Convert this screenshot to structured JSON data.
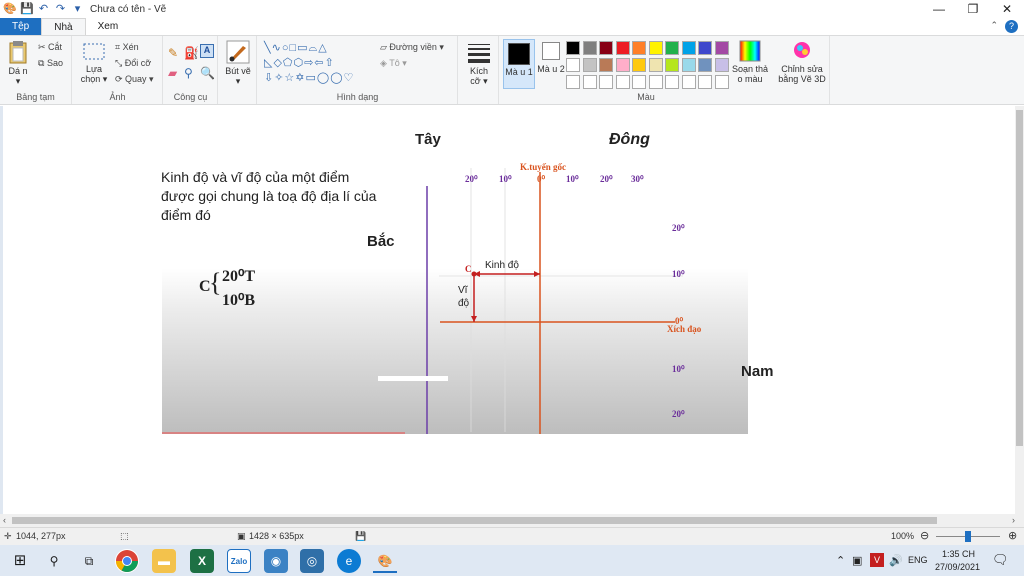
{
  "window": {
    "title": "Chưa có tên - Vẽ",
    "controls": [
      "—",
      "❐",
      "✕"
    ]
  },
  "tabs": [
    {
      "label": "Tệp"
    },
    {
      "label": "Nhà"
    },
    {
      "label": "Xem"
    }
  ],
  "ribbon": {
    "clipboard": {
      "paste": "Dá n ▾",
      "cut": "Cắt",
      "copy": "Sao",
      "group": "Bảng tạm"
    },
    "image": {
      "select": "Lựa chọn ▾",
      "crop": "Xén",
      "resize": "Đổi cỡ",
      "rotate": "Quay ▾",
      "group": "Ảnh"
    },
    "tools": {
      "group": "Công cụ"
    },
    "brushes": {
      "label": "Bút vẽ ▾"
    },
    "shapes": {
      "outline": "Đường viền ▾",
      "fill": "Tô ▾",
      "group": "Hình dạng"
    },
    "size": {
      "label": "Kích cỡ ▾"
    },
    "color1": {
      "label": "Mà u 1"
    },
    "color2": {
      "label": "Mà u 2"
    },
    "colors": {
      "group": "Màu",
      "row1": [
        "#000000",
        "#7f7f7f",
        "#880015",
        "#ed1c24",
        "#ff7f27",
        "#fff200",
        "#22b14c",
        "#00a2e8",
        "#3f48cc",
        "#a349a4"
      ],
      "row2": [
        "#ffffff",
        "#c3c3c3",
        "#b97a57",
        "#ffaec9",
        "#ffc90e",
        "#efe4b0",
        "#b5e61d",
        "#99d9ea",
        "#7092be",
        "#c8bfe7"
      ],
      "row3": [
        "#ffffff",
        "#ffffff",
        "#ffffff",
        "#ffffff",
        "#ffffff",
        "#ffffff",
        "#ffffff",
        "#ffffff",
        "#ffffff",
        "#ffffff"
      ]
    },
    "edit_colors": {
      "label": "Soạn thả o màu"
    },
    "paint3d": {
      "label": "Chỉnh sửa bằng Vẽ 3D"
    }
  },
  "canvas": {
    "tay": "Tây",
    "dong": "Đông",
    "bac": "Bắc",
    "nam": "Nam",
    "definition": [
      "Kinh độ và vĩ độ của một điểm",
      "được gọi chung là toạ độ địa lí của",
      "điểm đó"
    ],
    "coord_letter": "C",
    "coord_lon": "20⁰T",
    "coord_lat": "10⁰B",
    "prime_meridian": "K.tuyến gốc",
    "top_ticks": [
      "20⁰",
      "10⁰",
      "0⁰",
      "10⁰",
      "20⁰",
      "30⁰"
    ],
    "right_ticks": [
      "20⁰",
      "10⁰",
      "0⁰",
      "10⁰",
      "20⁰"
    ],
    "equator": "Xích đạo",
    "point_c": "C",
    "kinh_do": "Kinh độ",
    "vi_do": [
      "Vĩ",
      "độ"
    ]
  },
  "status": {
    "cursor": "1044, 277px",
    "size": "1428 × 635px",
    "zoom": "100%"
  },
  "taskbar": {
    "lang": "ENG",
    "time": "1:35 CH",
    "date": "27/09/2021",
    "apps": [
      "windows-icon",
      "search-icon",
      "task-view-icon",
      "chrome-icon",
      "file-explorer-icon",
      "excel-icon",
      "zalo-icon",
      "remote-icon",
      "network-icon",
      "edge-icon",
      "paint-icon"
    ]
  }
}
